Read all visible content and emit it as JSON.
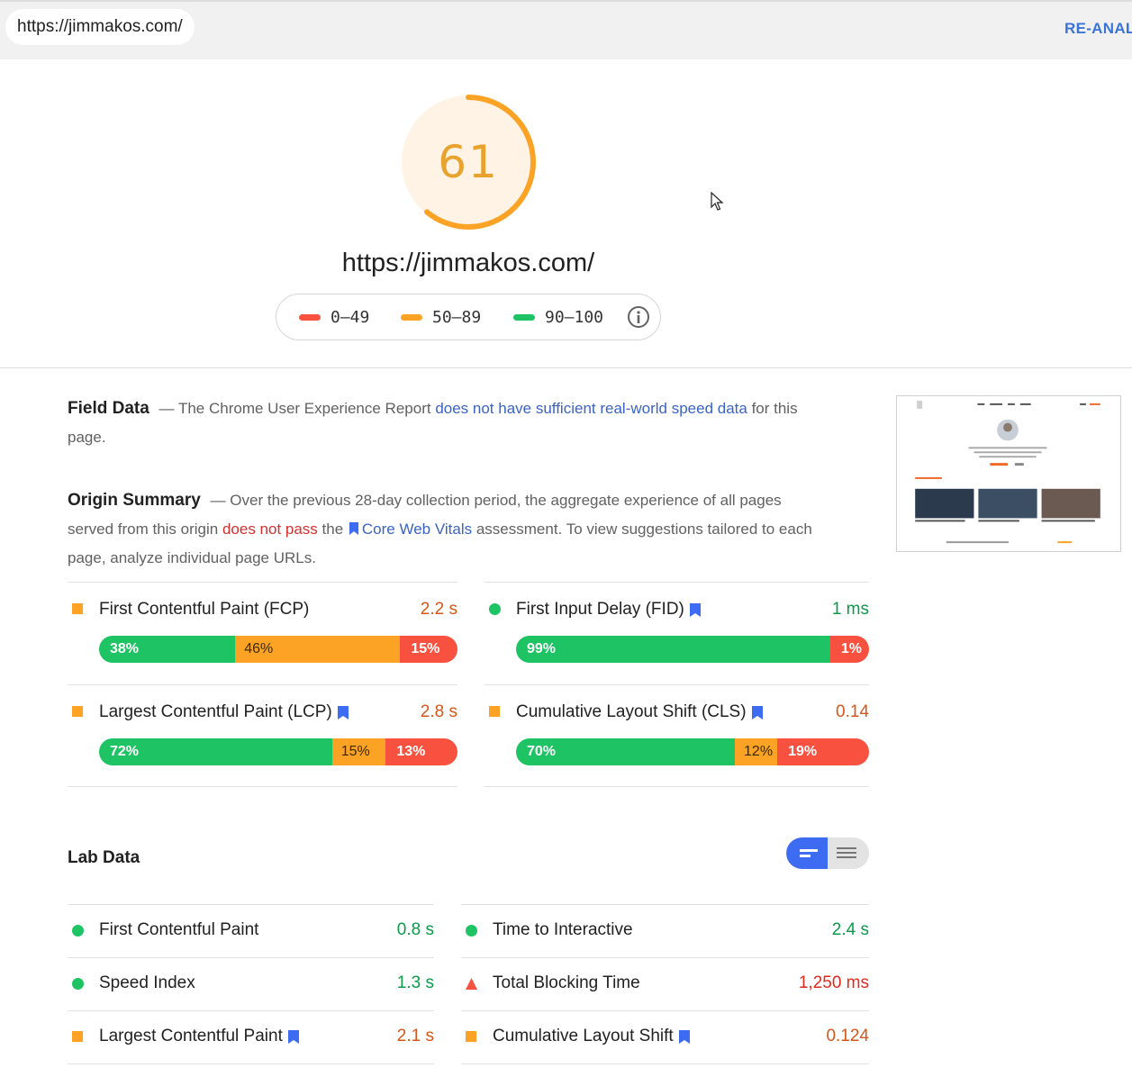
{
  "topbar": {
    "url": "https://jimmakos.com/",
    "reanalyze_label": "RE-ANALY"
  },
  "score": {
    "value": "61",
    "fraction": 0.61,
    "color": "#fca325",
    "page_url": "https://jimmakos.com/"
  },
  "legend": {
    "items": [
      {
        "label": "0–49",
        "color": "#f8513f"
      },
      {
        "label": "50–89",
        "color": "#fca325"
      },
      {
        "label": "90–100",
        "color": "#1ec463"
      }
    ],
    "info_icon": "info-icon"
  },
  "field_data": {
    "heading": "Field Data",
    "text_before": "— The Chrome User Experience Report ",
    "link": "does not have sufficient real-world speed data",
    "text_after": " for this page."
  },
  "origin_summary": {
    "heading": "Origin Summary",
    "text_1": "— Over the previous 28-day collection period, the aggregate experience of all pages served from this origin ",
    "fail_text": "does not pass",
    "text_2": " the ",
    "link": "Core Web Vitals",
    "text_3": " assessment. To view suggestions tailored to each page, analyze individual page URLs."
  },
  "origin_metrics": [
    {
      "label": "First Contentful Paint (FCP)",
      "value": "2.2 s",
      "status": "average",
      "bookmark": false,
      "distribution": [
        {
          "pct": "38%",
          "share": 38,
          "kind": "g"
        },
        {
          "pct": "46%",
          "share": 46,
          "kind": "o"
        },
        {
          "pct": "15%",
          "share": 16,
          "kind": "r"
        }
      ]
    },
    {
      "label": "First Input Delay (FID)",
      "value": "1 ms",
      "status": "good",
      "bookmark": true,
      "distribution": [
        {
          "pct": "99%",
          "share": 89,
          "kind": "g"
        },
        {
          "pct": "1%",
          "share": 11,
          "kind": "r"
        }
      ]
    },
    {
      "label": "Largest Contentful Paint (LCP)",
      "value": "2.8 s",
      "status": "average",
      "bookmark": true,
      "distribution": [
        {
          "pct": "72%",
          "share": 65,
          "kind": "g"
        },
        {
          "pct": "15%",
          "share": 15,
          "kind": "o"
        },
        {
          "pct": "13%",
          "share": 20,
          "kind": "r"
        }
      ]
    },
    {
      "label": "Cumulative Layout Shift (CLS)",
      "value": "0.14",
      "status": "average",
      "bookmark": true,
      "distribution": [
        {
          "pct": "70%",
          "share": 62,
          "kind": "g"
        },
        {
          "pct": "12%",
          "share": 12,
          "kind": "o"
        },
        {
          "pct": "19%",
          "share": 26,
          "kind": "r"
        }
      ]
    }
  ],
  "lab_data": {
    "heading": "Lab Data",
    "metrics": [
      {
        "label": "First Contentful Paint",
        "value": "0.8 s",
        "status": "good",
        "bookmark": false
      },
      {
        "label": "Time to Interactive",
        "value": "2.4 s",
        "status": "good",
        "bookmark": false
      },
      {
        "label": "Speed Index",
        "value": "1.3 s",
        "status": "good",
        "bookmark": false
      },
      {
        "label": "Total Blocking Time",
        "value": "1,250 ms",
        "status": "poor",
        "bookmark": false
      },
      {
        "label": "Largest Contentful Paint",
        "value": "2.1 s",
        "status": "average",
        "bookmark": true
      },
      {
        "label": "Cumulative Layout Shift",
        "value": "0.124",
        "status": "average",
        "bookmark": true
      }
    ]
  },
  "colors": {
    "good": "#0c9a4a",
    "average": "#d4561a",
    "poor": "#e02a1c",
    "link": "#3b63c4",
    "bookmark": "#3d6cf2"
  }
}
